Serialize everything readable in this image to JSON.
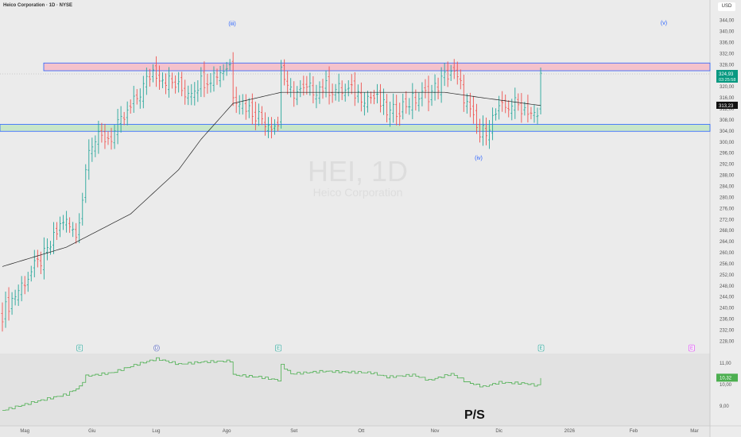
{
  "header": {
    "title": "Heico Corporation · 1D · NYSE",
    "currency": "USD"
  },
  "watermark": {
    "symbol": "HEI, 1D",
    "name": "Heico Corporation"
  },
  "colors": {
    "up": "#26a69a",
    "down": "#ef5350",
    "level": "#2962ff",
    "resistance_fill": "#f4c2cc",
    "support_fill": "#c8e6c9",
    "ma": "#222222",
    "ps": "#4caf50"
  },
  "annotations": {
    "wave3": "(iii)",
    "wave4": "(iv)",
    "wave5": "(v)",
    "ps_label": "P/S"
  },
  "events": [
    {
      "label": "E",
      "day": 24
    },
    {
      "label": "D",
      "day": 48
    },
    {
      "label": "E",
      "day": 86
    },
    {
      "label": "E",
      "day": 168
    },
    {
      "label": "E",
      "day": 215
    }
  ],
  "chart_data": {
    "type": "ohlc",
    "title": "Heico Corporation · 1D · NYSE",
    "price_axis": {
      "ticks": [
        "344,00",
        "340,00",
        "336,00",
        "332,00",
        "328,00",
        "324,00",
        "320,00",
        "316,00",
        "312,00",
        "308,00",
        "304,00",
        "300,00",
        "296,00",
        "292,00",
        "288,00",
        "284,00",
        "280,00",
        "276,00",
        "272,00",
        "268,00",
        "264,00",
        "260,00",
        "256,00",
        "252,00",
        "248,00",
        "244,00",
        "240,00",
        "236,00",
        "232,00",
        "228,00"
      ],
      "range": [
        228,
        344
      ]
    },
    "time_axis": {
      "labels": [
        {
          "t": "Mag",
          "day": 7
        },
        {
          "t": "Giu",
          "day": 28
        },
        {
          "t": "Lug",
          "day": 48
        },
        {
          "t": "Ago",
          "day": 70
        },
        {
          "t": "Set",
          "day": 91
        },
        {
          "t": "Ott",
          "day": 112
        },
        {
          "t": "Nov",
          "day": 135
        },
        {
          "t": "Dic",
          "day": 155
        },
        {
          "t": "2026",
          "day": 177
        },
        {
          "t": "Feb",
          "day": 197
        },
        {
          "t": "Mar",
          "day": 216
        }
      ]
    },
    "close_anchors": [
      [
        0,
        238
      ],
      [
        7,
        250
      ],
      [
        14,
        260
      ],
      [
        19,
        272
      ],
      [
        23,
        266
      ],
      [
        25,
        280
      ],
      [
        27,
        300
      ],
      [
        34,
        302
      ],
      [
        39,
        310
      ],
      [
        43,
        318
      ],
      [
        47,
        326
      ],
      [
        52,
        322
      ],
      [
        57,
        318
      ],
      [
        62,
        322
      ],
      [
        67,
        325
      ],
      [
        71,
        328
      ],
      [
        72,
        318
      ],
      [
        77,
        312
      ],
      [
        82,
        308
      ],
      [
        86,
        306
      ],
      [
        87,
        328
      ],
      [
        89,
        318
      ],
      [
        94,
        318
      ],
      [
        99,
        320
      ],
      [
        109,
        318
      ],
      [
        116,
        316
      ],
      [
        121,
        310
      ],
      [
        126,
        314
      ],
      [
        134,
        318
      ],
      [
        140,
        326
      ],
      [
        143,
        320
      ],
      [
        146,
        310
      ],
      [
        149,
        302
      ],
      [
        154,
        310
      ],
      [
        159,
        314
      ],
      [
        164,
        312
      ],
      [
        167,
        308
      ],
      [
        168,
        324.93
      ]
    ],
    "ma_anchors": [
      [
        0,
        255
      ],
      [
        20,
        262
      ],
      [
        40,
        274
      ],
      [
        55,
        290
      ],
      [
        62,
        301
      ],
      [
        72,
        314
      ],
      [
        87,
        318
      ],
      [
        138,
        318
      ],
      [
        150,
        316
      ],
      [
        168,
        313.23
      ]
    ],
    "last_price": "324,93",
    "countdown": "03:25:58",
    "ma_value": "313,23",
    "resistance_zone": [
      325.8,
      328.6
    ],
    "support_zone": [
      303.9,
      306.4
    ],
    "ps": {
      "axis_ticks": [
        "11,00",
        "10,00",
        "9,00"
      ],
      "range": [
        8.5,
        11.3
      ],
      "last": "10,32",
      "anchors": [
        [
          0,
          8.8
        ],
        [
          10,
          9.2
        ],
        [
          20,
          9.55
        ],
        [
          24,
          9.9
        ],
        [
          26,
          10.4
        ],
        [
          34,
          10.55
        ],
        [
          42,
          10.95
        ],
        [
          48,
          11.2
        ],
        [
          55,
          10.95
        ],
        [
          62,
          11.05
        ],
        [
          71,
          11.1
        ],
        [
          72,
          10.45
        ],
        [
          80,
          10.35
        ],
        [
          86,
          10.2
        ],
        [
          87,
          10.9
        ],
        [
          90,
          10.5
        ],
        [
          100,
          10.62
        ],
        [
          115,
          10.55
        ],
        [
          120,
          10.35
        ],
        [
          128,
          10.45
        ],
        [
          133,
          10.2
        ],
        [
          140,
          10.5
        ],
        [
          145,
          10.1
        ],
        [
          150,
          9.9
        ],
        [
          155,
          10.1
        ],
        [
          163,
          10.05
        ],
        [
          167,
          9.95
        ],
        [
          168,
          10.32
        ]
      ]
    }
  }
}
